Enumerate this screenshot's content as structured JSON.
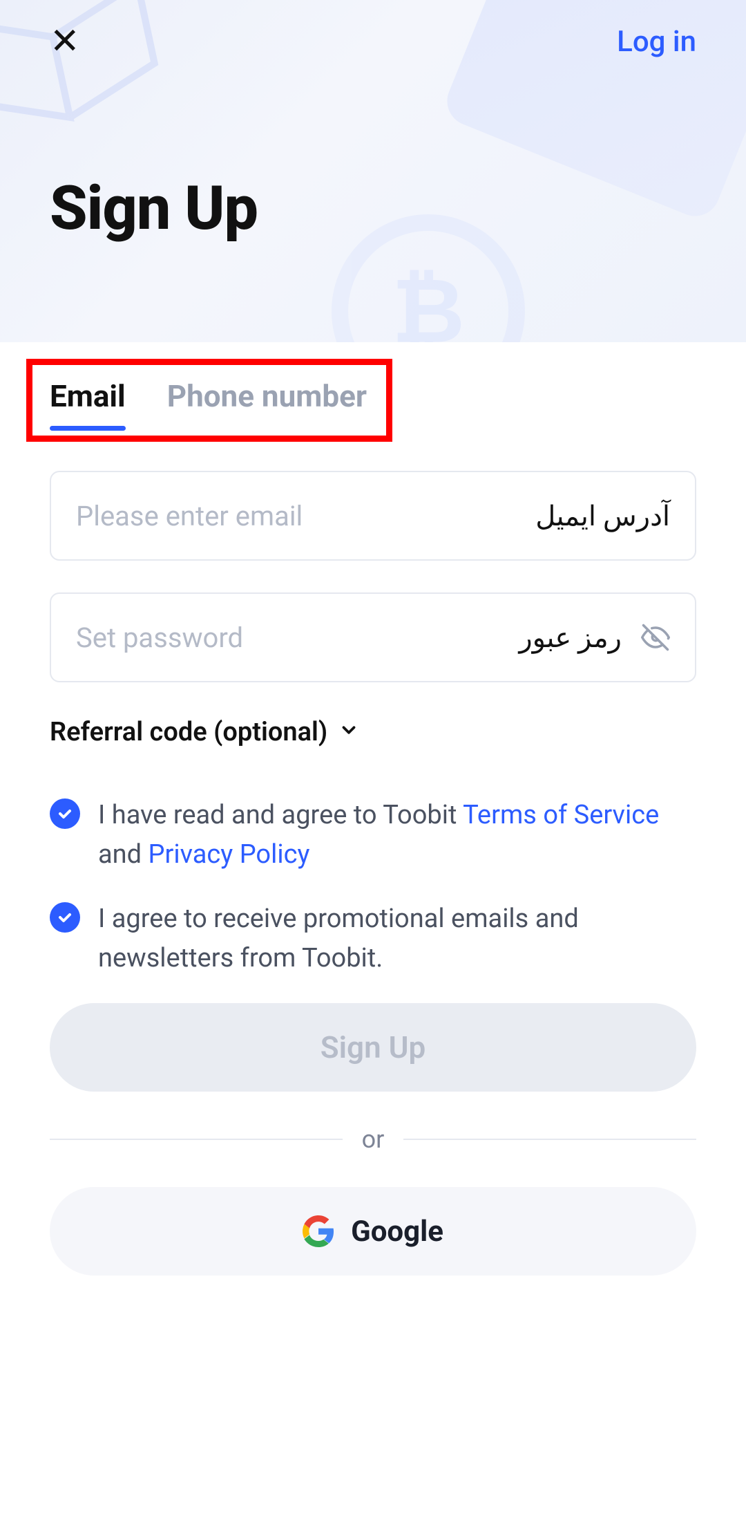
{
  "header": {
    "login_label": "Log in"
  },
  "page": {
    "title": "Sign Up"
  },
  "tabs": {
    "email": "Email",
    "phone": "Phone number"
  },
  "fields": {
    "email_placeholder": "Please enter email",
    "email_label_rtl": "آدرس ایمیل",
    "password_placeholder": "Set password",
    "password_label_rtl": "رمز عبور"
  },
  "referral": {
    "label": "Referral code (optional)"
  },
  "agreements": {
    "terms_prefix": "I have read and agree to Toobit ",
    "terms_of_service": "Terms of Service",
    "terms_mid": " and ",
    "privacy_policy": "Privacy Policy",
    "promo": "I agree to receive promotional emails and newsletters from Toobit."
  },
  "buttons": {
    "signup": "Sign Up",
    "or": "or",
    "google": "Google"
  }
}
